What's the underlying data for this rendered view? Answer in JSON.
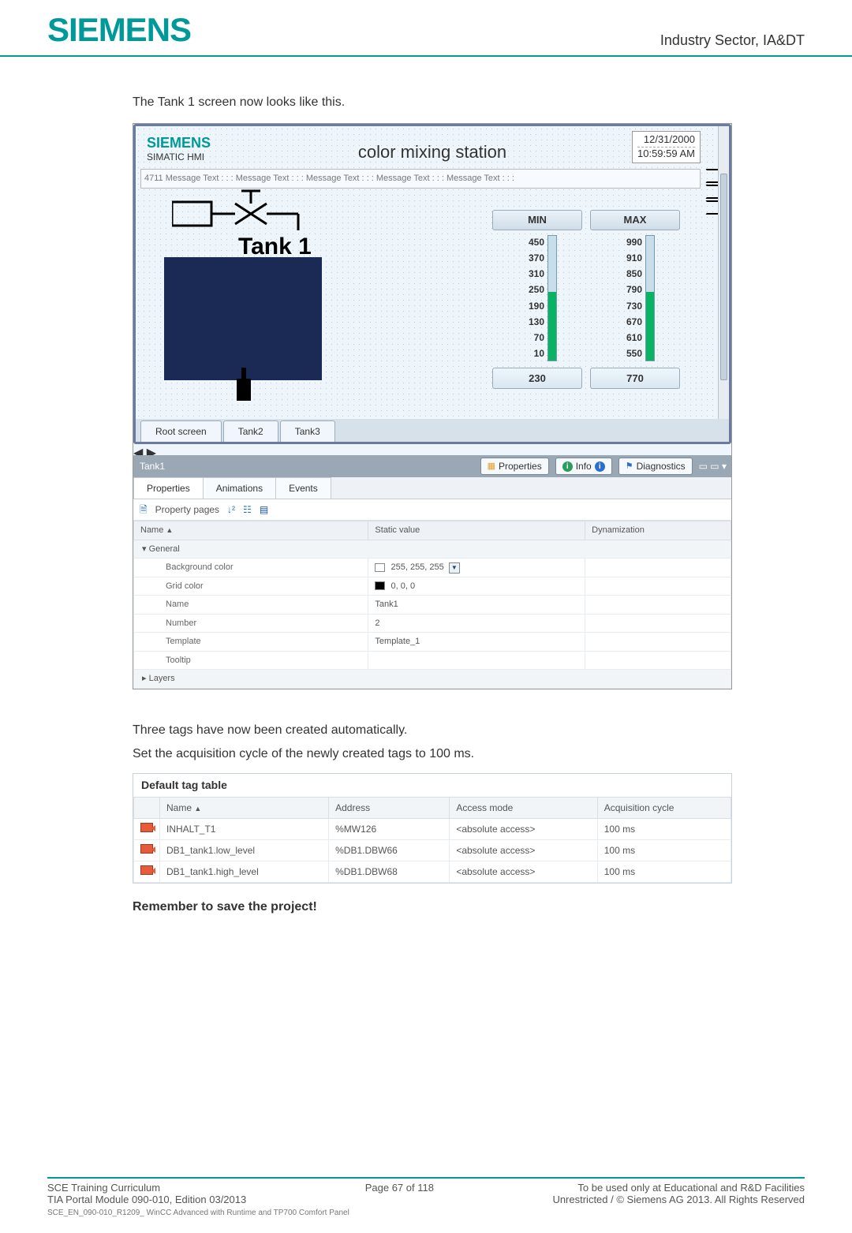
{
  "page": {
    "header_right": "Industry Sector, IA&DT",
    "logo_text": "SIEMENS"
  },
  "body": {
    "intro": "The Tank 1 screen now looks like this.",
    "three_tags": "Three tags have now been created automatically.",
    "set_cycle": "Set the acquisition cycle of the newly created tags to 100 ms.",
    "remember": "Remember to save the project!"
  },
  "hmi": {
    "logo": "SIEMENS",
    "simatic": "SIMATIC HMI",
    "title": "color mixing station",
    "date": "12/31/2000",
    "time": "10:59:59 AM",
    "msg_bar": "4711 Message Text : : : Message Text : : : Message Text : : : Message Text : : : Message Text : : :",
    "tank_label": "Tank 1",
    "tabs": [
      "Root screen",
      "Tank2",
      "Tank3"
    ],
    "gauges": {
      "min": {
        "caption": "MIN",
        "ticks": [
          "450",
          "370",
          "310",
          "250",
          "190",
          "130",
          "70",
          "10"
        ],
        "value": "230"
      },
      "max": {
        "caption": "MAX",
        "ticks": [
          "990",
          "910",
          "850",
          "790",
          "730",
          "670",
          "610",
          "550"
        ],
        "value": "770"
      }
    }
  },
  "prop_pane": {
    "title": "Tank1",
    "properties_btn": "Properties",
    "info_btn": "Info",
    "diag_btn": "Diagnostics",
    "tabs": [
      "Properties",
      "Animations",
      "Events"
    ],
    "toolbar_label": "Property pages",
    "columns": [
      "Name",
      "Static value",
      "Dynamization"
    ],
    "general_group": "General",
    "layers_group": "Layers",
    "rows": [
      {
        "label": "Background color",
        "value": "255, 255, 255",
        "swatch": "#ffffff",
        "dropdown": true
      },
      {
        "label": "Grid color",
        "value": "0, 0, 0",
        "swatch": "#000000"
      },
      {
        "label": "Name",
        "value": "Tank1"
      },
      {
        "label": "Number",
        "value": "2"
      },
      {
        "label": "Template",
        "value": "Template_1"
      },
      {
        "label": "Tooltip",
        "value": ""
      }
    ]
  },
  "tags": {
    "title": "Default tag table",
    "columns": [
      "Name",
      "Address",
      "Access mode",
      "Acquisition cycle"
    ],
    "rows": [
      {
        "name": "INHALT_T1",
        "addr": "%MW126",
        "mode": "<absolute access>",
        "cycle": "100 ms"
      },
      {
        "name": "DB1_tank1.low_level",
        "addr": "%DB1.DBW66",
        "mode": "<absolute access>",
        "cycle": "100 ms"
      },
      {
        "name": "DB1_tank1.high_level",
        "addr": "%DB1.DBW68",
        "mode": "<absolute access>",
        "cycle": "100 ms"
      }
    ]
  },
  "footer": {
    "left": "SCE Training Curriculum",
    "left2": "TIA Portal Module 090-010, Edition 03/2013",
    "center": "Page 67 of 118",
    "right1": "To be used only at Educational and R&D Facilities",
    "right2": "Unrestricted / © Siemens AG 2013. All Rights Reserved",
    "tiny": "SCE_EN_090-010_R1209_ WinCC Advanced with Runtime and TP700 Comfort Panel"
  }
}
